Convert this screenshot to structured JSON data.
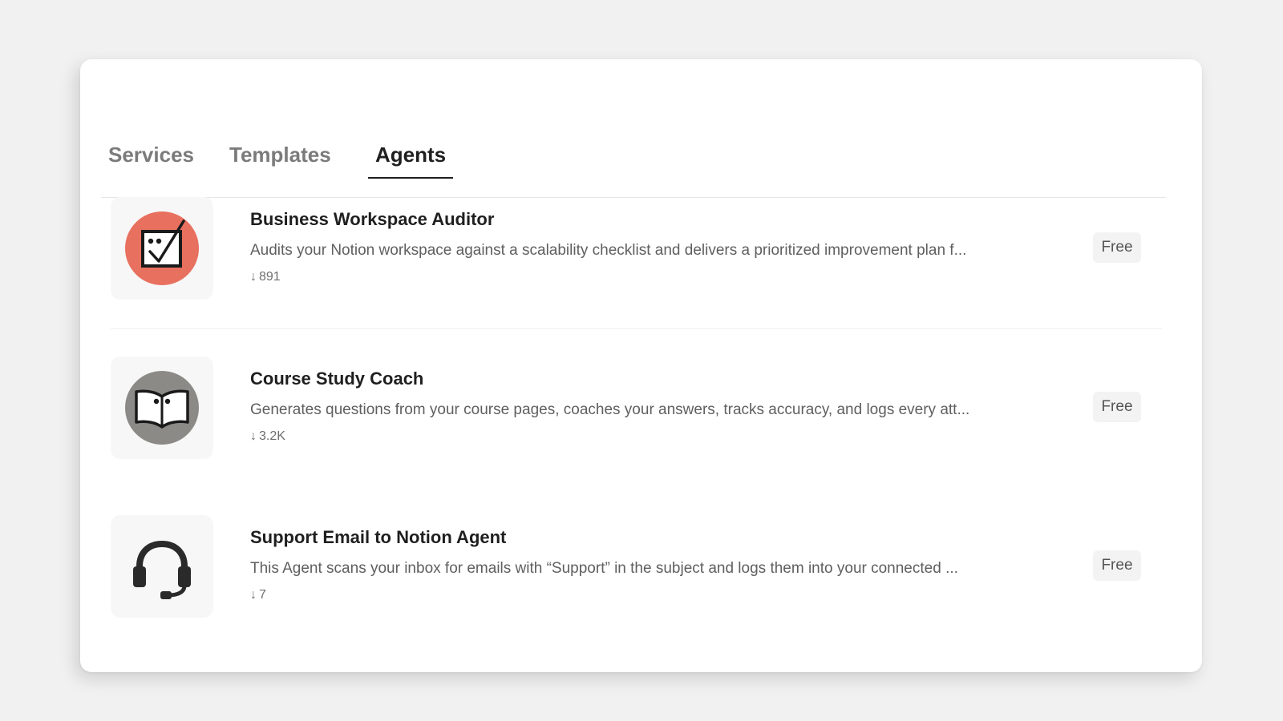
{
  "tabs": [
    {
      "label": "Services",
      "active": false
    },
    {
      "label": "Templates",
      "active": false
    },
    {
      "label": "Agents",
      "active": true
    }
  ],
  "agents": [
    {
      "icon": "audit-checklist-icon",
      "title": "Business Workspace Auditor",
      "description": "Audits your Notion workspace against a scalability checklist and delivers a prioritized improvement plan f...",
      "downloads": "891",
      "price": "Free",
      "icon_bg": "#e8705f"
    },
    {
      "icon": "open-book-icon",
      "title": "Course Study Coach",
      "description": "Generates questions from your course pages, coaches your answers, tracks accuracy, and logs every att...",
      "downloads": "3.2K",
      "price": "Free",
      "icon_bg": "#8c8a86"
    },
    {
      "icon": "headset-icon",
      "title": "Support Email to Notion Agent",
      "description": "This Agent scans your inbox for emails with “Support” in the subject and logs them into your connected ...",
      "downloads": "7",
      "price": "Free",
      "icon_bg": "#f7f7f7"
    }
  ],
  "colors": {
    "background": "#f1f1f1",
    "card": "#ffffff",
    "active_tab": "#1f1f1f",
    "inactive_tab": "#7b7b7b"
  }
}
